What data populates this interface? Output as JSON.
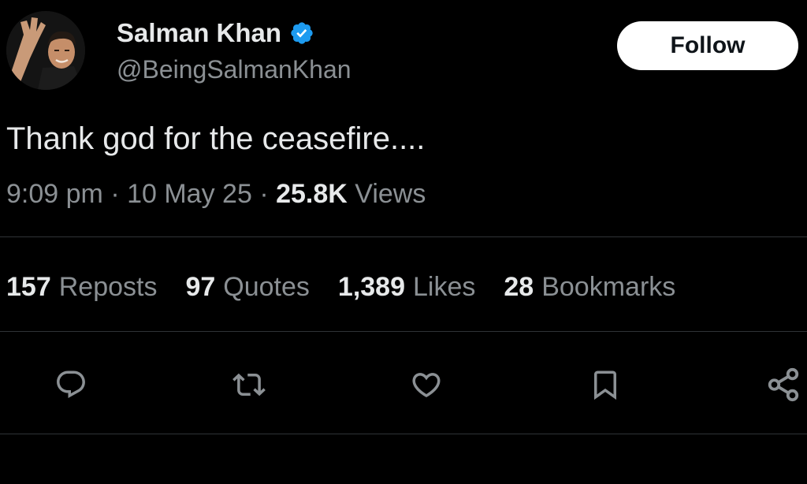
{
  "author": {
    "display_name": "Salman Khan",
    "handle": "@BeingSalmanKhan",
    "verified": true
  },
  "follow_button": {
    "label": "Follow"
  },
  "tweet": {
    "text": "Thank god for the ceasefire....",
    "time": "9:09 pm",
    "date": "10 May 25",
    "separator": "·",
    "views_count": "25.8K",
    "views_label": "Views"
  },
  "stats": [
    {
      "count": "157",
      "label": "Reposts"
    },
    {
      "count": "97",
      "label": "Quotes"
    },
    {
      "count": "1,389",
      "label": "Likes"
    },
    {
      "count": "28",
      "label": "Bookmarks"
    }
  ],
  "actions": [
    {
      "icon": "reply-icon"
    },
    {
      "icon": "repost-icon"
    },
    {
      "icon": "like-icon"
    },
    {
      "icon": "bookmark-icon"
    },
    {
      "icon": "share-icon"
    }
  ],
  "colors": {
    "background": "#000000",
    "text_primary": "#e7e9ea",
    "text_secondary": "#8b9094",
    "verified_blue": "#1d9bf0",
    "divider": "#2f3336"
  }
}
